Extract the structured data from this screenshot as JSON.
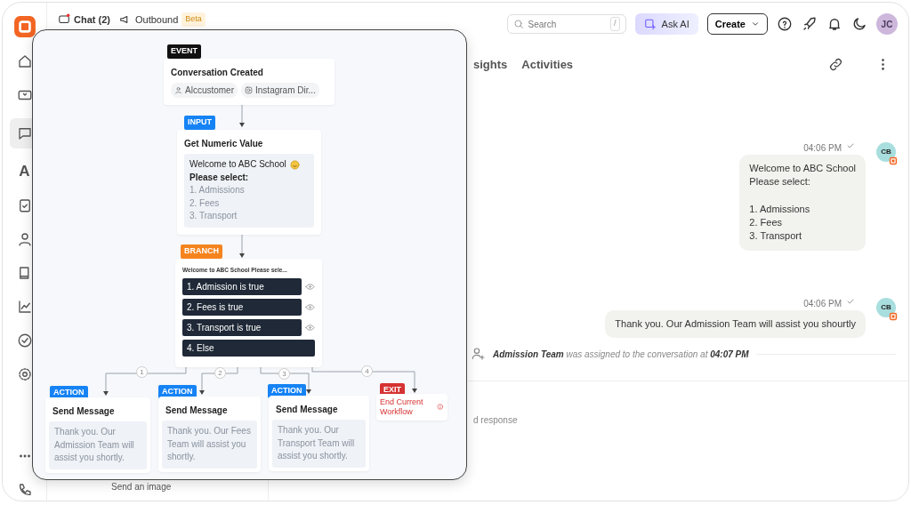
{
  "rail": [
    {
      "kind": "logo"
    },
    {
      "kind": "home",
      "selected": false
    },
    {
      "kind": "ticket",
      "selected": false
    },
    {
      "kind": "chat",
      "selected": true
    },
    {
      "kind": "letter",
      "label": "A",
      "selected": false
    },
    {
      "kind": "task",
      "selected": false
    },
    {
      "kind": "contacts",
      "selected": false
    },
    {
      "kind": "book",
      "selected": false
    },
    {
      "kind": "chart",
      "selected": false
    },
    {
      "kind": "check",
      "selected": false
    },
    {
      "kind": "gear",
      "selected": false
    },
    {
      "kind": "more",
      "selected": false
    },
    {
      "kind": "phone",
      "selected": false
    }
  ],
  "header": {
    "tabs": [
      {
        "label": "Chat (2)",
        "unread": true,
        "selected": true
      },
      {
        "label": "Outbound",
        "badge": "Beta",
        "selected": false
      }
    ],
    "search": {
      "placeholder": "Search",
      "shortcut": "/"
    },
    "ask_ai": "Ask AI",
    "create": "Create",
    "avatar": "JC"
  },
  "chat": {
    "tabs": [
      {
        "label": "sights",
        "selected": false
      },
      {
        "label": "Activities",
        "selected": false
      }
    ],
    "messages": [
      {
        "time": "04:06 PM",
        "avatar": "CB",
        "text": "Welcome to ABC School\nPlease select:\n\n1. Admissions\n2. Fees\n3. Transport"
      },
      {
        "time": "04:06 PM",
        "avatar": "CB",
        "text": "Thank you. Our Admission Team will assist you shourtly"
      }
    ],
    "event": "**Admission Team** was assigned to the conversation at **04:07 PM**",
    "composer_placeholder": "d response",
    "list_preview": "Send an image"
  },
  "workflow": {
    "event": {
      "tag": "EVENT",
      "title": "Conversation Created",
      "chips": [
        {
          "kind": "person",
          "label": "Alccustomer"
        },
        {
          "kind": "instagram",
          "label": "Instagram Dir..."
        }
      ]
    },
    "input": {
      "tag": "INPUT",
      "title": "Get Numeric Value",
      "prompt": [
        "Welcome to ABC School",
        "Please select:"
      ],
      "options": [
        "1. Admissions",
        "2. Fees",
        "3. Transport"
      ]
    },
    "branch": {
      "tag": "BRANCH",
      "caption": "Welcome to ABC School Please sele...",
      "conditions": [
        {
          "label": "1. Admission is true",
          "preview": true
        },
        {
          "label": "2. Fees is true",
          "preview": true
        },
        {
          "label": "3. Transport is true",
          "preview": true
        },
        {
          "label": "4. Else",
          "preview": false
        }
      ]
    },
    "steps": [
      {
        "kind": "action",
        "number": "1",
        "tag": "ACTION",
        "title": "Send Message",
        "message": "Thank you. Our Admission Team will assist you shortly."
      },
      {
        "kind": "action",
        "number": "2",
        "tag": "ACTION",
        "title": "Send Message",
        "message": "Thank you. Our Fees Team will assist you shortly."
      },
      {
        "kind": "action",
        "number": "3",
        "tag": "ACTION",
        "title": "Send Message",
        "message": "Thank you. Our Transport Team will assist you shortly."
      },
      {
        "kind": "exit",
        "number": "4",
        "tag": "EXIT",
        "title": "End Current Workflow"
      }
    ]
  }
}
